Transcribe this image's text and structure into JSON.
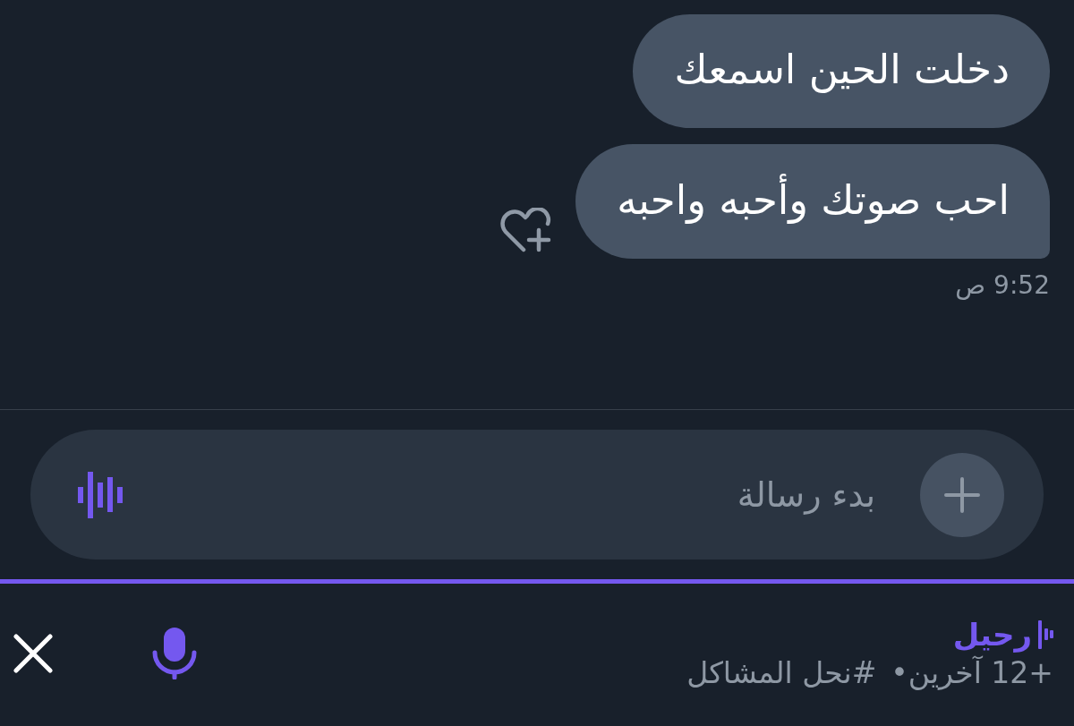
{
  "messages": [
    {
      "text": "دخلت الحين اسمعك"
    },
    {
      "text": "احب صوتك وأحبه واحبه"
    }
  ],
  "timestamp": "9:52 ص",
  "composer": {
    "placeholder": "بدء رسالة"
  },
  "voice_bar": {
    "user": "رحيل",
    "members": "+12 آخرين•",
    "channel": "#نحل المشاكل",
    "muted": false
  }
}
